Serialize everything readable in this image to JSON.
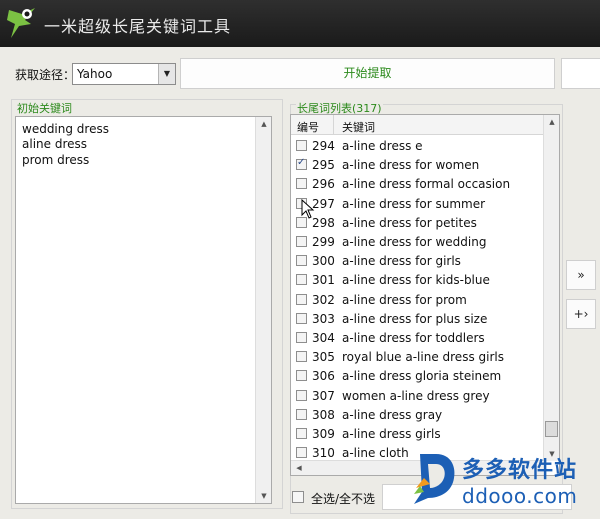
{
  "app": {
    "title": "一米超级长尾关键词工具"
  },
  "source": {
    "label": "获取途径：",
    "selected": "Yahoo"
  },
  "start_button": "开始提取",
  "seed_panel": {
    "title": "初始关键词",
    "lines": [
      "wedding dress",
      "aline dress",
      "prom dress"
    ]
  },
  "list_panel": {
    "title": "长尾词列表(317)",
    "col_number": "编号",
    "col_keyword": "关键词",
    "rows": [
      {
        "num": "294",
        "kw": "a-line dress e",
        "checked": false
      },
      {
        "num": "295",
        "kw": "a-line dress for women",
        "checked": true
      },
      {
        "num": "296",
        "kw": "a-line dress formal occasion",
        "checked": false
      },
      {
        "num": "297",
        "kw": "a-line dress for summer",
        "checked": false
      },
      {
        "num": "298",
        "kw": "a-line dress for petites",
        "checked": false
      },
      {
        "num": "299",
        "kw": "a-line dress for wedding",
        "checked": false
      },
      {
        "num": "300",
        "kw": "a-line dress for girls",
        "checked": false
      },
      {
        "num": "301",
        "kw": "a-line dress for kids-blue",
        "checked": false
      },
      {
        "num": "302",
        "kw": "a-line dress for prom",
        "checked": false
      },
      {
        "num": "303",
        "kw": "a-line dress for plus size",
        "checked": false
      },
      {
        "num": "304",
        "kw": "a-line dress for toddlers",
        "checked": false
      },
      {
        "num": "305",
        "kw": "royal blue a-line dress girls",
        "checked": false
      },
      {
        "num": "306",
        "kw": "a-line dress gloria steinem",
        "checked": false
      },
      {
        "num": "307",
        "kw": "women a-line dress grey",
        "checked": false
      },
      {
        "num": "308",
        "kw": "a-line dress gray",
        "checked": false
      },
      {
        "num": "309",
        "kw": "a-line dress girls",
        "checked": false
      },
      {
        "num": "310",
        "kw": "a-line cloth",
        "checked": false
      }
    ]
  },
  "side_buttons": {
    "move_all": "»",
    "move_one": "+›"
  },
  "select_all_label": "全选/全不选",
  "watermark": {
    "name": "多多软件站",
    "url": "ddooo.com"
  }
}
